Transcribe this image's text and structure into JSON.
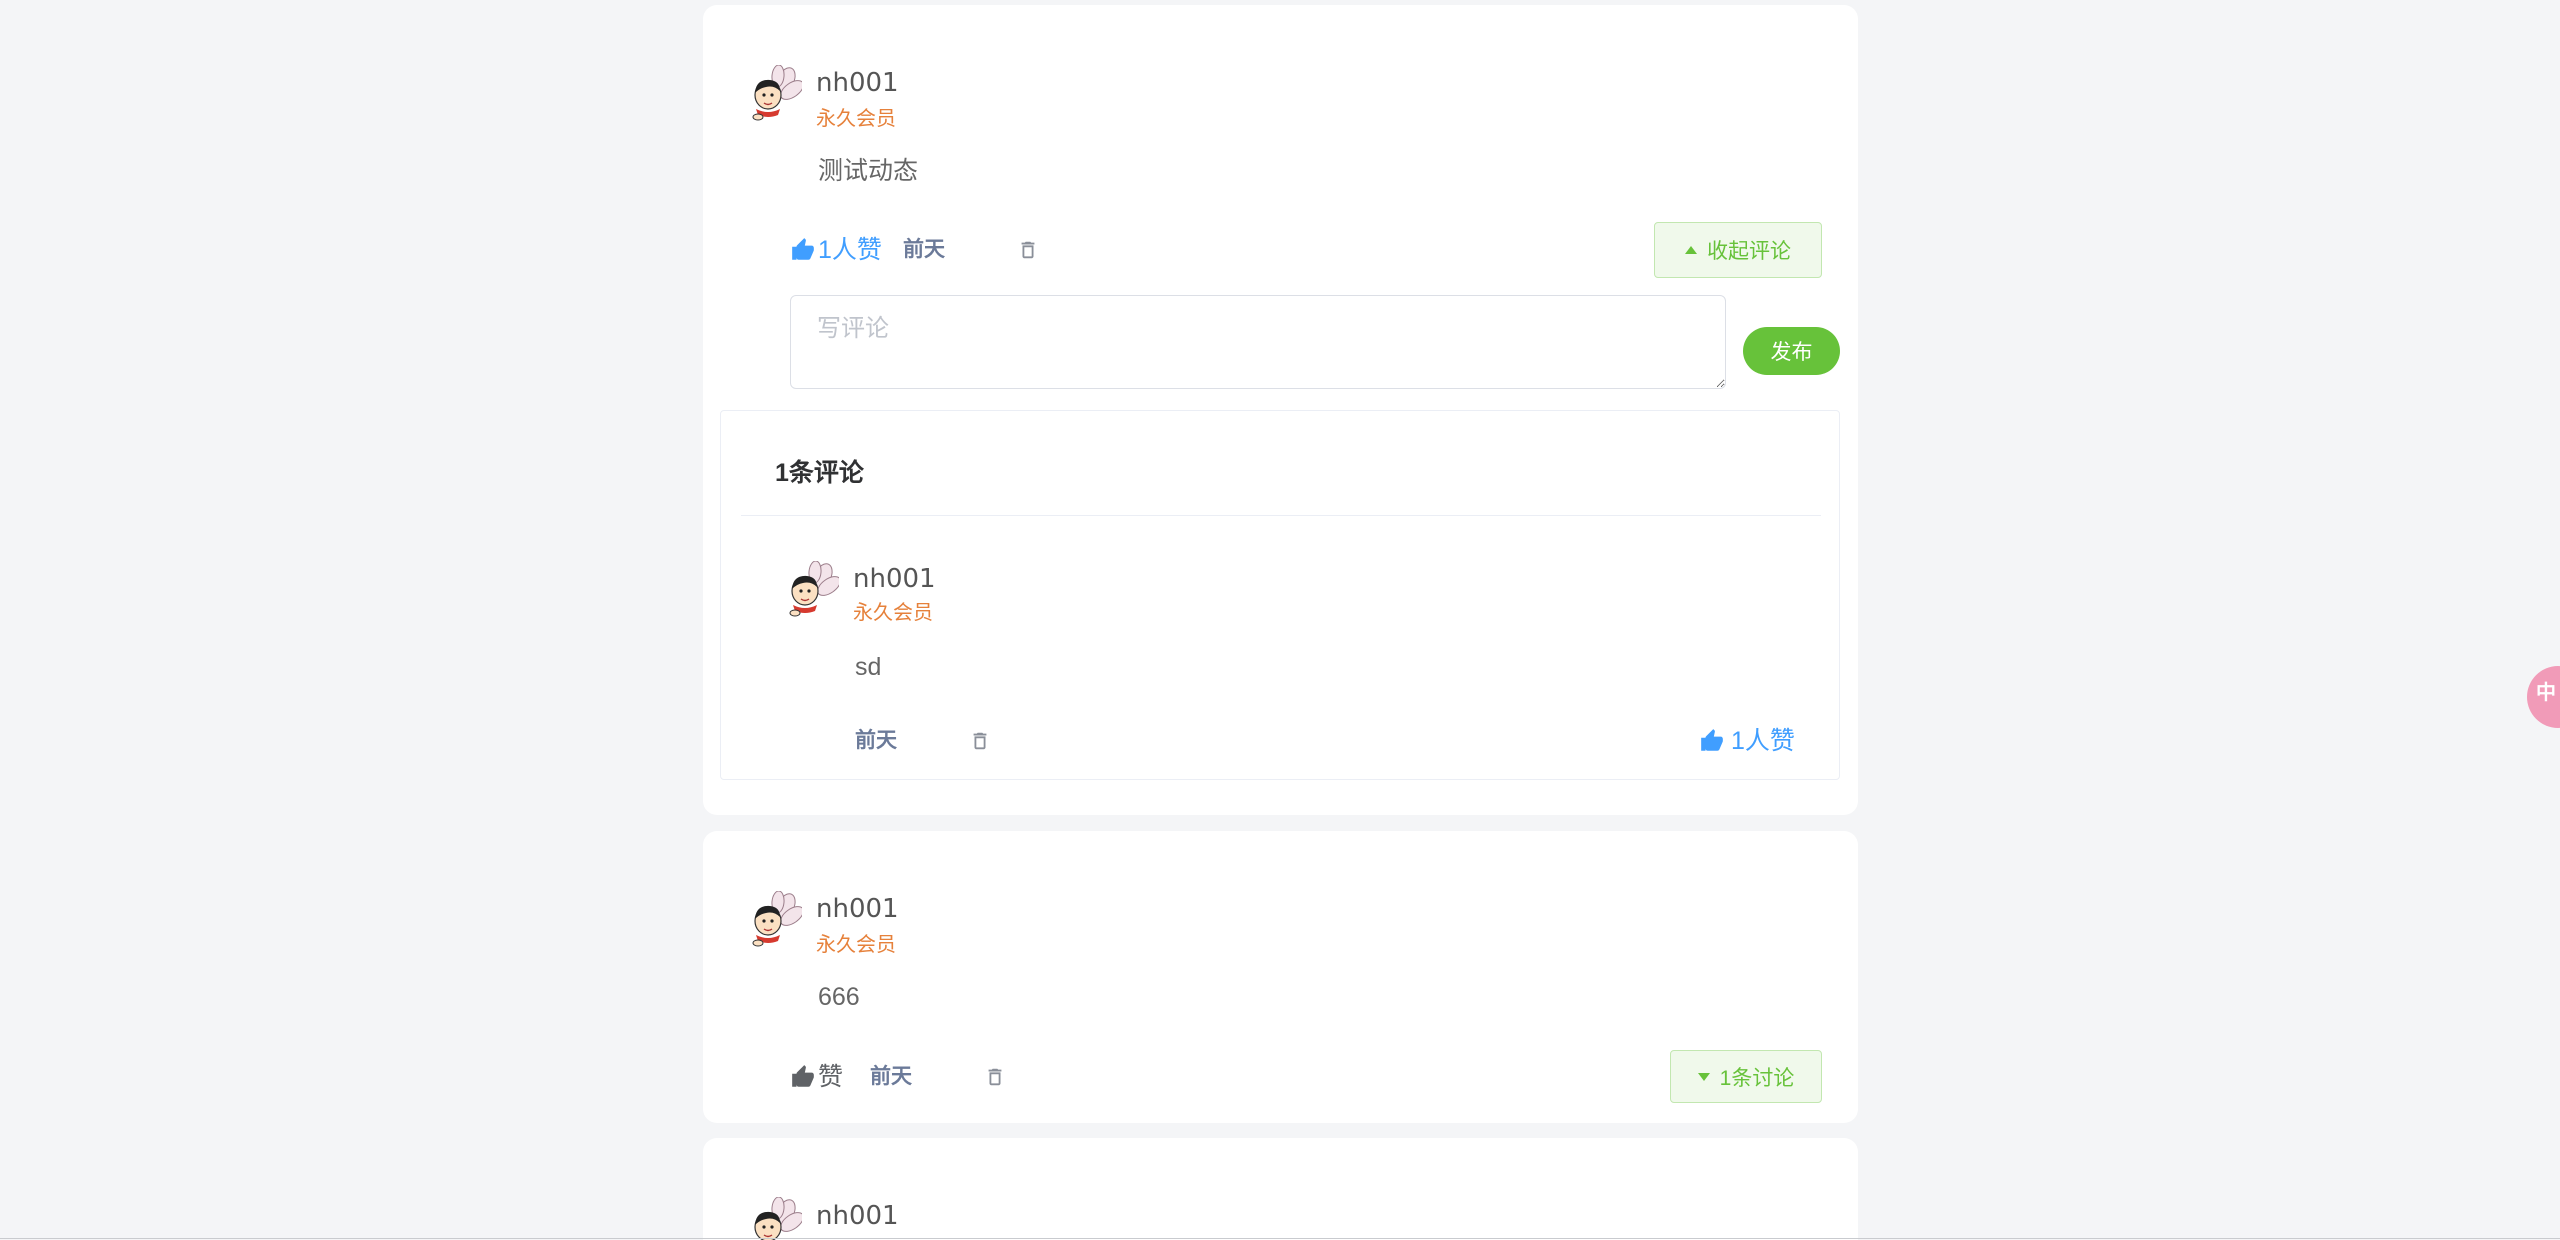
{
  "colors": {
    "page_bg": "#f4f5f7",
    "card_bg": "#ffffff",
    "accent_green": "#67c23a",
    "accent_green_bg": "#f0f9eb",
    "accent_green_border": "#c2e7b0",
    "link_blue": "#409eff",
    "badge_orange": "#e6813b",
    "text_muted": "#666666",
    "time_gray": "#6b7a99",
    "icon_gray": "#8a8f99",
    "float_pink": "#f19bb8"
  },
  "icons": {
    "like": "thumbs-up-icon",
    "delete": "trash-icon",
    "collapse": "caret-up-icon",
    "expand": "caret-down-icon",
    "avatar": "cartoon-avatar"
  },
  "posts": [
    {
      "user": {
        "name": "nh001",
        "badge": "永久会员"
      },
      "content": "测试动态",
      "like_label": "1人赞",
      "time": "前天",
      "toggle_label": "收起评论",
      "comment_box": {
        "placeholder": "写评论",
        "submit_label": "发布"
      },
      "comments_header": "1条评论",
      "comments": [
        {
          "user": {
            "name": "nh001",
            "badge": "永久会员"
          },
          "content": "sd",
          "time": "前天",
          "like_label": "1人赞"
        }
      ]
    },
    {
      "user": {
        "name": "nh001",
        "badge": "永久会员"
      },
      "content": "666",
      "like_label": "赞",
      "time": "前天",
      "toggle_label": "1条讨论"
    },
    {
      "user": {
        "name": "nh001"
      }
    }
  ],
  "floating_button": {
    "label": "中"
  }
}
